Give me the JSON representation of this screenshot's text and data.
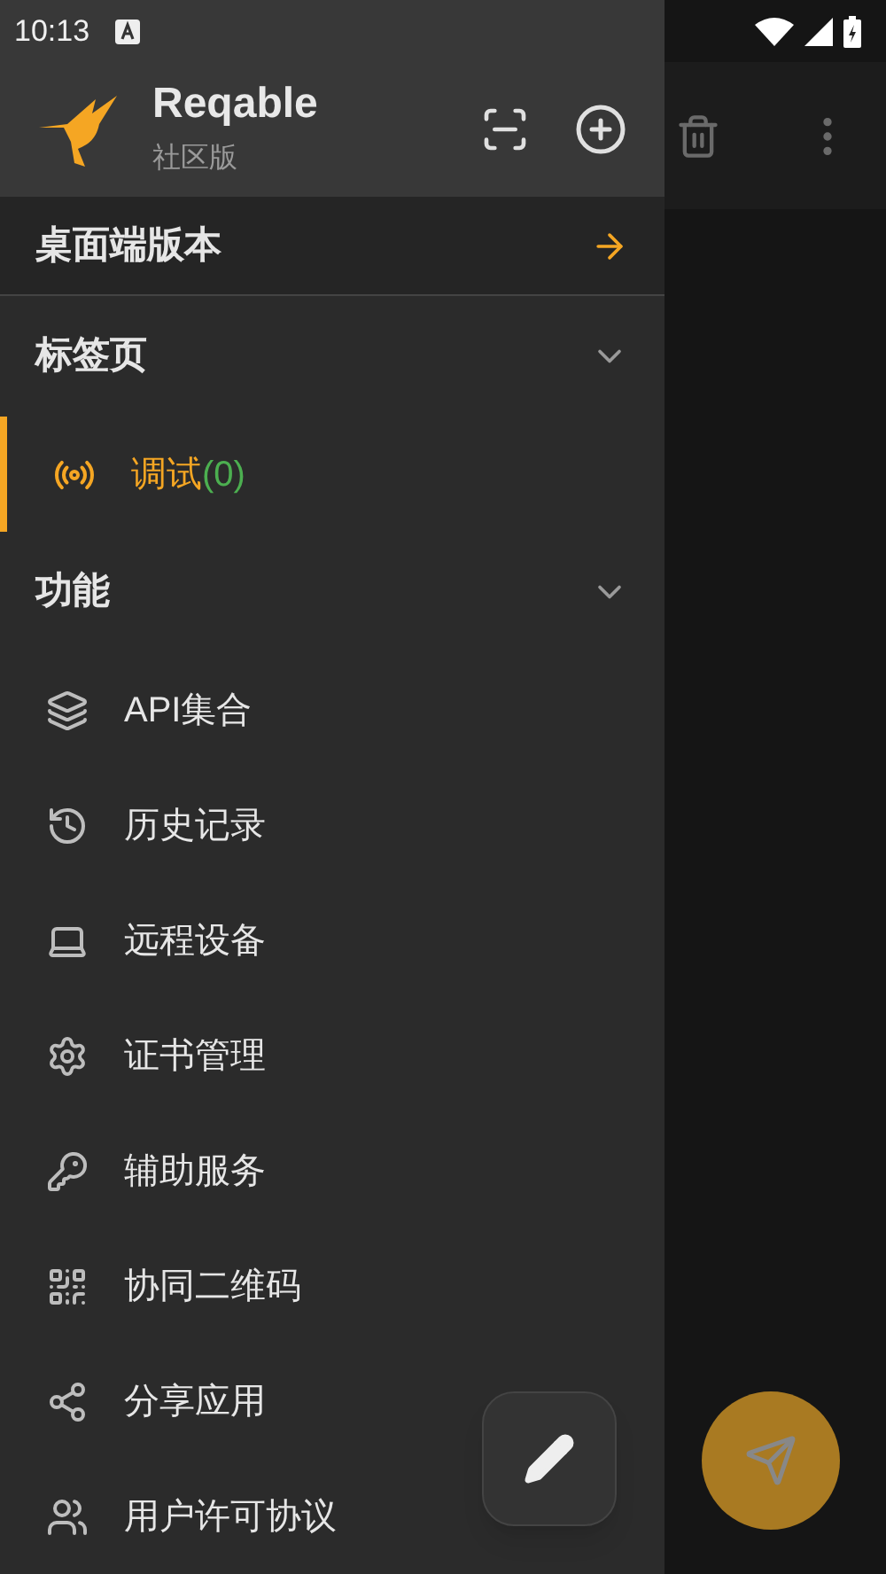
{
  "status_bar": {
    "time": "10:13"
  },
  "app": {
    "name": "Reqable",
    "edition": "社区版"
  },
  "desktop_link": {
    "label": "桌面端版本"
  },
  "sections": [
    {
      "title": "标签页",
      "expanded": true,
      "kind": "tabs",
      "items": [
        {
          "label": "调试",
          "count": "(0)",
          "selected": true
        }
      ]
    },
    {
      "title": "功能",
      "expanded": true,
      "kind": "features",
      "items": [
        {
          "label": "API集合",
          "selected": false
        },
        {
          "label": "历史记录",
          "selected": false
        },
        {
          "label": "远程设备",
          "selected": false
        },
        {
          "label": "证书管理",
          "selected": false
        },
        {
          "label": "辅助服务",
          "selected": false
        },
        {
          "label": "协同二维码",
          "selected": false
        },
        {
          "label": "分享应用",
          "selected": false
        },
        {
          "label": "用户许可协议",
          "selected": false
        }
      ]
    }
  ]
}
